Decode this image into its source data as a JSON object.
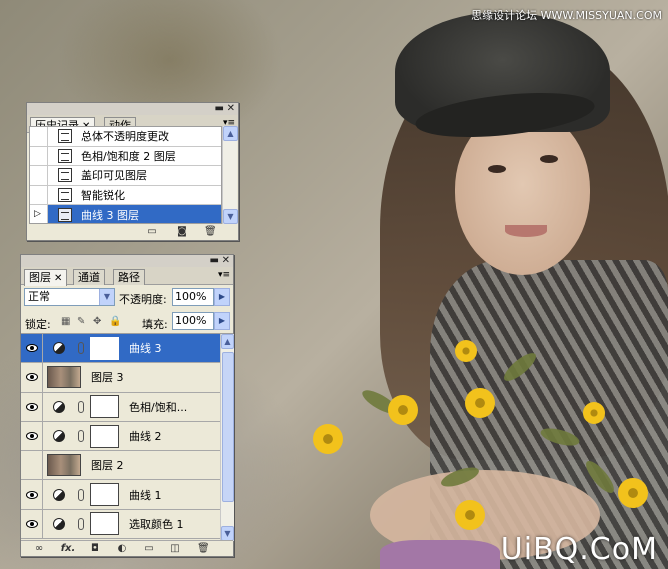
{
  "watermarks": {
    "top": "思缘设计论坛",
    "top_url": "WWW.MISSYUAN.COM",
    "bottom": "UiBQ.CoM"
  },
  "history_panel": {
    "tabs": [
      {
        "label": "历史记录",
        "active": true,
        "closable": true
      },
      {
        "label": "动作",
        "active": false,
        "closable": false
      }
    ],
    "steps": [
      {
        "label": "总体不透明度更改",
        "selected": false
      },
      {
        "label": "色相/饱和度 2 图层",
        "selected": false
      },
      {
        "label": "盖印可见图层",
        "selected": false
      },
      {
        "label": "智能锐化",
        "selected": false
      },
      {
        "label": "曲线 3 图层",
        "selected": true
      }
    ],
    "footer_icons": [
      "new-document-icon",
      "snapshot-icon",
      "trash-icon"
    ]
  },
  "layers_panel": {
    "tabs": [
      {
        "label": "图层",
        "active": true,
        "closable": true
      },
      {
        "label": "通道",
        "active": false,
        "closable": false
      },
      {
        "label": "路径",
        "active": false,
        "closable": false
      }
    ],
    "blend_mode": "正常",
    "opacity_label": "不透明度:",
    "opacity_value": "100%",
    "lock_label": "锁定:",
    "fill_label": "填充:",
    "fill_value": "100%",
    "layers": [
      {
        "name": "曲线 3",
        "type": "adjustment",
        "selected": true
      },
      {
        "name": "图层 3",
        "type": "pixel",
        "selected": false
      },
      {
        "name": "色相/饱和...",
        "type": "adjustment",
        "selected": false
      },
      {
        "name": "曲线 2",
        "type": "adjustment",
        "selected": false
      },
      {
        "name": "图层 2",
        "type": "pixel",
        "selected": false
      },
      {
        "name": "曲线 1",
        "type": "adjustment",
        "selected": false
      },
      {
        "name": "选取颜色 1",
        "type": "adjustment",
        "selected": false
      }
    ],
    "footer_icons": [
      "link-icon",
      "fx-icon",
      "add-mask-icon",
      "adjustment-layer-icon",
      "group-folder-icon",
      "new-layer-icon",
      "trash-icon"
    ],
    "fx_label": "fx."
  },
  "colors": {
    "selection": "#316ac5",
    "panel_bg": "#ece9d8",
    "scroll_button": "#c1d3fb"
  }
}
